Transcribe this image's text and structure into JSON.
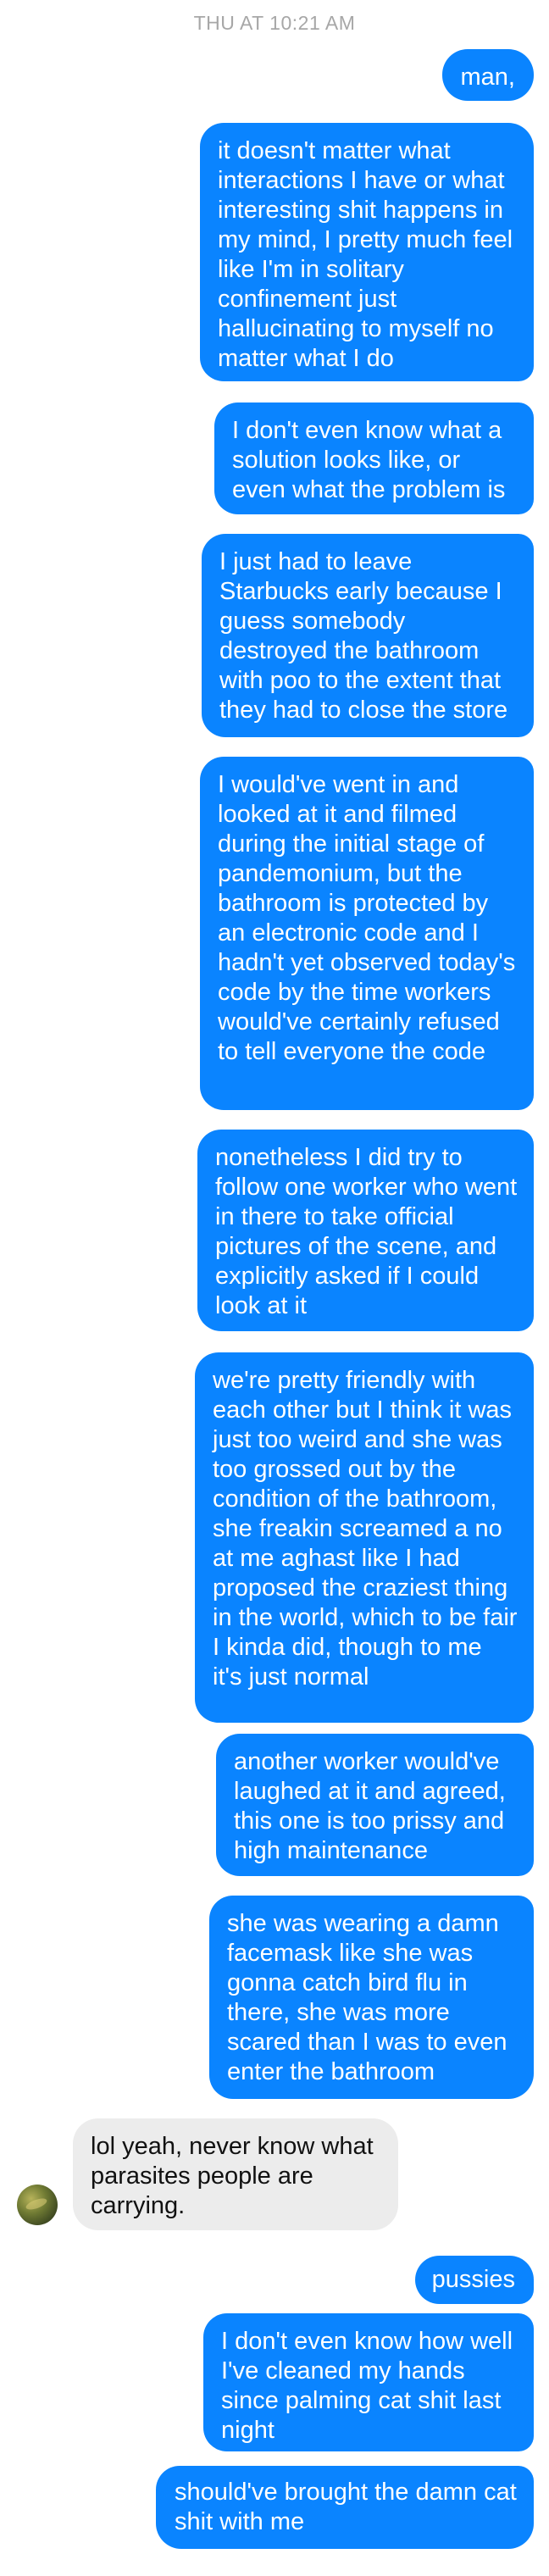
{
  "timestamp": "THU AT 10:21 AM",
  "messages": [
    {
      "from": "me",
      "text": "man,"
    },
    {
      "from": "me",
      "text": "it doesn't matter what interactions I have or what interesting shit happens in my mind, I pretty much feel like I'm in solitary confinement just hallucinating to myself no matter what I do"
    },
    {
      "from": "me",
      "text": "I don't even know what a solution looks like, or even what the problem is"
    },
    {
      "from": "me",
      "text": "I just had to leave Starbucks early because I guess somebody destroyed the bathroom with poo to the extent that they had to close the store"
    },
    {
      "from": "me",
      "text": "I would've went in and looked at it and filmed during the initial stage of pandemonium, but the bathroom is protected by an electronic code and I hadn't yet observed today's code by the time workers would've certainly refused to tell everyone the code"
    },
    {
      "from": "me",
      "text": "nonetheless I did try to follow one worker who went in there to take official pictures of the scene, and explicitly asked if I could look at it"
    },
    {
      "from": "me",
      "text": "we're pretty friendly with each other but I think it was just too weird and she was too grossed out by the condition of the bathroom, she freakin screamed a no at me aghast like I had proposed the craziest thing in the world, which to be fair I kinda did, though to me it's just normal"
    },
    {
      "from": "me",
      "text": "another worker would've laughed at it and agreed, this one is too prissy and high maintenance"
    },
    {
      "from": "me",
      "text": "she was wearing a damn facemask like she was gonna catch bird flu in there, she was more scared than I was to even enter the bathroom"
    },
    {
      "from": "them",
      "text": "lol yeah, never know what parasites people are carrying."
    },
    {
      "from": "me",
      "text": "pussies"
    },
    {
      "from": "me",
      "text": "I don't even know how well I've cleaned my hands since palming cat shit last night"
    },
    {
      "from": "me",
      "text": "should've brought the damn cat shit with me"
    }
  ],
  "colors": {
    "outgoing_bubble": "#0a84ff",
    "incoming_bubble": "#ececec",
    "timestamp": "#a7a7a7"
  },
  "icons": {
    "contact_avatar": "contact-avatar"
  }
}
